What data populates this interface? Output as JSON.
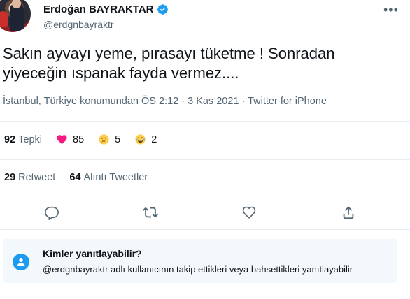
{
  "author": {
    "name": "Erdoğan BAYRAKTAR",
    "handle": "@erdgnbayraktr",
    "verified": true
  },
  "tweet": {
    "text_line1": "Sakın ayvayı yeme, pırasayı tüketme ! Sonradan",
    "text_line2": "yiyeceğin ıspanak fayda vermez....",
    "meta": "İstanbul, Türkiye konumundan ÖS 2:12 · 3 Kas 2021 · Twitter for iPhone"
  },
  "reactions": {
    "total_count": "92",
    "total_label": "Tepki",
    "heart_count": "85",
    "thinking_count": "5",
    "laughing_count": "2"
  },
  "engagement": {
    "retweet_count": "29",
    "retweet_label": "Retweet",
    "quote_count": "64",
    "quote_label": "Alıntı Tweetler"
  },
  "actions": [
    "reply-icon",
    "retweet-icon",
    "like-icon",
    "share-icon"
  ],
  "reply_restriction": {
    "title": "Kimler yanıtlayabilir?",
    "subtitle": "@erdgnbayraktr adlı kullanıcının takip ettikleri veya bahsettikleri yanıtlayabilir"
  },
  "colors": {
    "accent": "#1d9bf0",
    "text": "#0f1419",
    "muted": "#536471",
    "heart": "#f91880"
  }
}
